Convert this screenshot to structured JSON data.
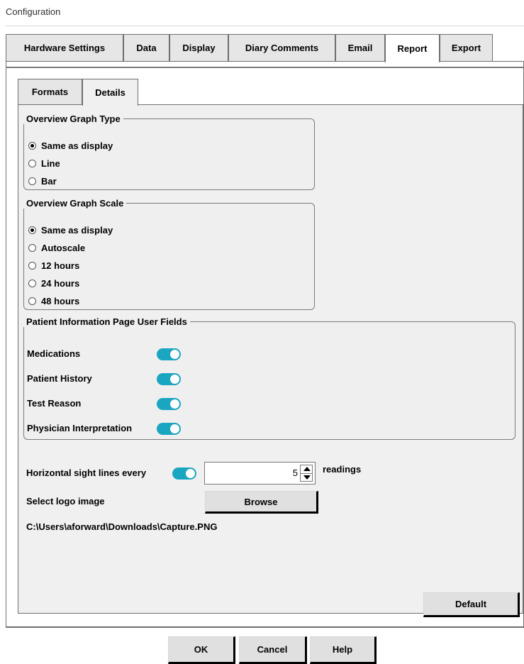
{
  "window": {
    "title": "Configuration"
  },
  "outer_tabs": [
    {
      "label": "Hardware Settings"
    },
    {
      "label": "Data"
    },
    {
      "label": "Display"
    },
    {
      "label": "Diary Comments"
    },
    {
      "label": "Email"
    },
    {
      "label": "Report"
    },
    {
      "label": "Export"
    }
  ],
  "outer_active_tab": "Report",
  "inner_tabs": [
    {
      "label": "Formats"
    },
    {
      "label": "Details"
    }
  ],
  "inner_active_tab": "Details",
  "graph_type": {
    "legend": "Overview Graph Type",
    "options": [
      "Same as display",
      "Line",
      "Bar"
    ],
    "selected": "Same as display"
  },
  "graph_scale": {
    "legend": "Overview Graph Scale",
    "options": [
      "Same as display",
      "Autoscale",
      "12 hours",
      "24 hours",
      "48 hours"
    ],
    "selected": "Same as display"
  },
  "user_fields": {
    "legend": "Patient Information Page User Fields",
    "items": [
      {
        "label": "Medications",
        "enabled": true
      },
      {
        "label": "Patient History",
        "enabled": true
      },
      {
        "label": "Test Reason",
        "enabled": true
      },
      {
        "label": "Physician Interpretation",
        "enabled": true
      }
    ]
  },
  "sight_lines": {
    "label": "Horizontal sight lines every",
    "enabled": true,
    "value": "5",
    "unit": "readings"
  },
  "logo": {
    "label": "Select logo image",
    "browse_label": "Browse",
    "path": "C:\\Users\\aforward\\Downloads\\Capture.PNG"
  },
  "buttons": {
    "default": "Default",
    "ok": "OK",
    "cancel": "Cancel",
    "help": "Help"
  },
  "colors": {
    "toggle_on": "#1aa6c0",
    "panel_bg": "#f0f0f0",
    "tab_bg": "#e6e6e6"
  }
}
